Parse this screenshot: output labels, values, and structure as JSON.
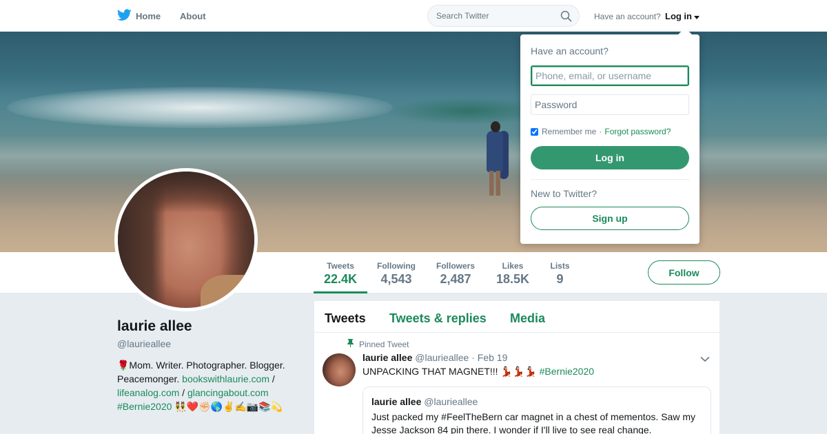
{
  "colors": {
    "accent": "#1b8a5a",
    "login_button": "#339870",
    "brand_icon": "#1da1f2",
    "text_secondary": "#657786",
    "background": "#e6ecf0"
  },
  "topnav": {
    "home_label": "Home",
    "about_label": "About",
    "search_placeholder": "Search Twitter",
    "have_account": "Have an account?",
    "login_label": "Log in"
  },
  "icons": {
    "brand": "twitter-bird-icon",
    "search": "search-icon",
    "caret": "caret-down-icon",
    "pin": "pin-icon",
    "chevron": "chevron-down-icon"
  },
  "stats": [
    {
      "label": "Tweets",
      "value": "22.4K",
      "active": true
    },
    {
      "label": "Following",
      "value": "4,543",
      "active": false
    },
    {
      "label": "Followers",
      "value": "2,487",
      "active": false
    },
    {
      "label": "Likes",
      "value": "18.5K",
      "active": false
    },
    {
      "label": "Lists",
      "value": "9",
      "active": false
    }
  ],
  "follow_label": "Follow",
  "profile": {
    "name": "laurie allee",
    "handle": "@laurieallee",
    "bio_prefix": "🌹Mom. Writer. Photographer. Blogger. Peacemonger. ",
    "link1": "bookswithlaurie.com",
    "sep1": " / ",
    "link2": "lifeanalog.com",
    "sep2": " / ",
    "link3": "glancingabout.com",
    "link4": "#Bernie2020",
    "bio_suffix": " 👯❤️✊🏻🌎✌️✍️📷📚💫"
  },
  "timeline": {
    "tabs": [
      "Tweets",
      "Tweets & replies",
      "Media"
    ],
    "pinned_label": "Pinned Tweet",
    "tweet": {
      "name": "laurie allee",
      "handle": "@laurieallee",
      "date": "· Feb 19",
      "text": "UNPACKING THAT MAGNET!!! 💃🏻💃🏻💃🏻 ",
      "hashtag": "#Bernie2020"
    },
    "quote": {
      "name": "laurie allee",
      "handle": "@laurieallee",
      "text": "Just packed my #FeelTheBern car magnet in a chest of mementos. Saw my Jesse Jackson 84 pin there. I wonder if I'll live to see real change."
    }
  },
  "login_dropdown": {
    "title": "Have an account?",
    "username_placeholder": "Phone, email, or username",
    "password_placeholder": "Password",
    "remember_label": "Remember me",
    "separator": "·",
    "forgot_label": "Forgot password?",
    "login_button": "Log in",
    "new_label": "New to Twitter?",
    "signup_button": "Sign up"
  }
}
